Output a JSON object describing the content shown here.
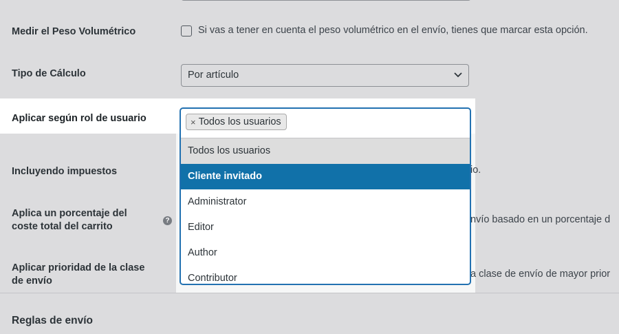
{
  "rows": {
    "peso": {
      "label": "Medir el Peso Volumétrico",
      "description": "Si vas a tener en cuenta el peso volumétrico en el envío, tienes que marcar esta opción."
    },
    "calculo": {
      "label": "Tipo de Cálculo",
      "value": "Por artículo"
    },
    "rol": {
      "label": "Aplicar según rol de usuario",
      "chip": "Todos los usuarios",
      "chip_remove": "×",
      "options": [
        "Todos los usuarios",
        "Cliente invitado",
        "Administrator",
        "Editor",
        "Author",
        "Contributor"
      ]
    },
    "impuestos": {
      "label": "Incluyendo impuestos",
      "description_fragment": "io."
    },
    "porcentaje": {
      "label_line1": "Aplica un porcentaje del",
      "label_line2": "coste total del carrito",
      "help": "?",
      "description_fragment": "nvío basado en un porcentaje d"
    },
    "prioridad": {
      "label_line1": "Aplicar prioridad de la clase",
      "label_line2": "de envío",
      "description_fragment": "a clase de envío de mayor prior"
    }
  },
  "section": {
    "title": "Reglas de envío"
  },
  "colors": {
    "accent": "#2271b1",
    "active_option": "#1171a9"
  }
}
